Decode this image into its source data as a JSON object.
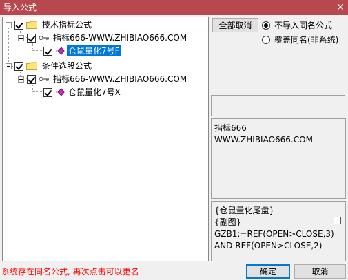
{
  "window": {
    "title": "导入公式",
    "close_glyph": "✕"
  },
  "tree": {
    "groups": [
      {
        "label": "技术指标公式",
        "checked": true,
        "child": {
          "label": "指标666-WWW.ZHIBIAO666.COM",
          "checked": true,
          "formula": {
            "label": "仓鼠量化7号F",
            "checked": true,
            "selected": true
          }
        }
      },
      {
        "label": "条件选股公式",
        "checked": true,
        "child": {
          "label": "指标666-WWW.ZHIBIAO666.COM",
          "checked": true,
          "formula": {
            "label": "仓鼠量化7号X",
            "checked": true,
            "selected": false
          }
        }
      }
    ]
  },
  "buttons": {
    "cancel_all": "全部取消",
    "ok": "确定",
    "cancel": "取消"
  },
  "options": {
    "no_import_same_name": "不导入同名公式",
    "overwrite_same_name": "覆盖同名(非系统)",
    "selected": "no_import_same_name"
  },
  "info_panel": {
    "text": "指标666\nWWW.ZHIBIAO666.COM"
  },
  "code_panel": {
    "text": "{仓鼠量化尾盘}\n{副图}\nGZB1:=REF(OPEN>CLOSE,3)\nAND REF(OPEN>CLOSE,2)"
  },
  "status": {
    "message": "系统存在同名公式, 再次点击可以更名",
    "color": "#ff0000"
  },
  "colors": {
    "titlebar": "#b7484f",
    "selection": "#0078d7"
  }
}
